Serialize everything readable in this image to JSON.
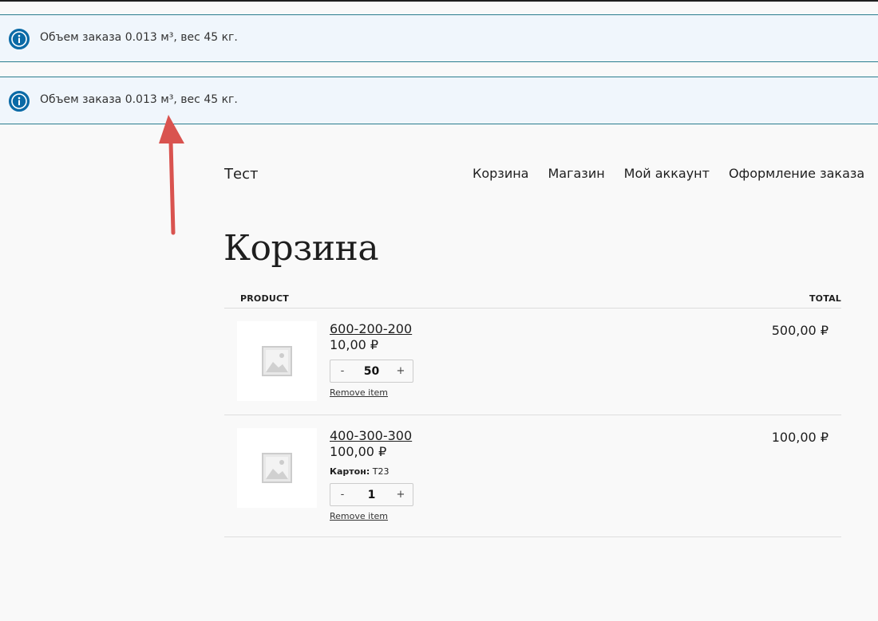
{
  "notices": [
    {
      "message": "Объем заказа 0.013 м³, вес 45 кг."
    },
    {
      "message": "Объем заказа 0.013 м³, вес 45 кг."
    }
  ],
  "header": {
    "site_title": "Тест",
    "nav": [
      "Корзина",
      "Магазин",
      "Мой аккаунт",
      "Оформление заказа"
    ]
  },
  "page_title": "Корзина",
  "cart": {
    "columns": {
      "product": "PRODUCT",
      "total": "TOTAL"
    },
    "items": [
      {
        "name": "600-200-200",
        "price": "10,00 ₽",
        "quantity": "50",
        "remove_label": "Remove item",
        "total": "500,00 ₽"
      },
      {
        "name": "400-300-300",
        "price": "100,00 ₽",
        "meta_label": "Картон:",
        "meta_value": "Т23",
        "quantity": "1",
        "remove_label": "Remove item",
        "total": "100,00 ₽"
      }
    ],
    "qty_minus": "-",
    "qty_plus": "+"
  },
  "colors": {
    "notice_bg": "#f0f6fc",
    "notice_border": "#2a7d8e",
    "info_icon": "#0a6aa6",
    "arrow": "#d9534f"
  },
  "icons": {
    "notice": "info-icon",
    "placeholder": "image-placeholder-icon",
    "annotation": "red-arrow"
  }
}
